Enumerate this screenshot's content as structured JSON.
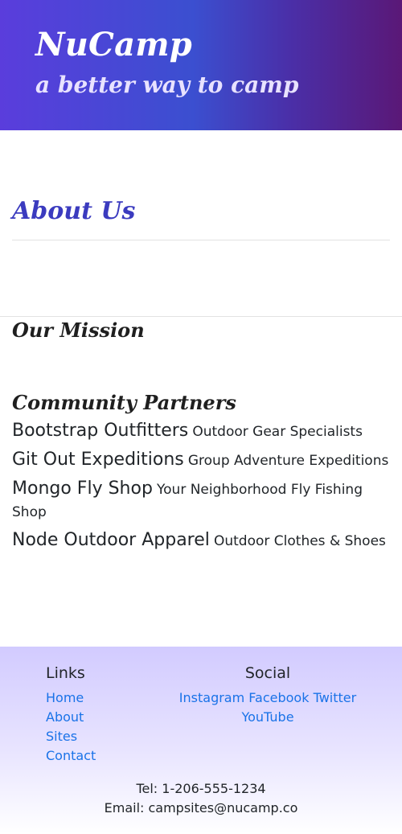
{
  "header": {
    "brand": "NuCamp",
    "tagline": "a better way to camp"
  },
  "about": {
    "title": "About Us"
  },
  "mission": {
    "heading": "Our Mission"
  },
  "partners": {
    "heading": "Community Partners",
    "items": [
      {
        "name": "Bootstrap Outfitters",
        "description": "Outdoor Gear Specialists"
      },
      {
        "name": "Git Out Expeditions",
        "description": "Group Adventure Expeditions"
      },
      {
        "name": "Mongo Fly Shop",
        "description": "Your Neighborhood Fly Fishing Shop"
      },
      {
        "name": "Node Outdoor Apparel",
        "description": "Outdoor Clothes & Shoes"
      }
    ]
  },
  "footer": {
    "links_title": "Links",
    "links": [
      "Home",
      "About",
      "Sites",
      "Contact"
    ],
    "social_title": "Social",
    "social": [
      "Instagram",
      "Facebook",
      "Twitter",
      "YouTube"
    ],
    "tel": "Tel: 1-206-555-1234",
    "email": "Email: campsites@nucamp.co"
  },
  "colors": {
    "header_gradient_start": "#5a3ddc",
    "header_gradient_end": "#5a1877",
    "about_title": "#3b3bbf",
    "link": "#1a73e8",
    "footer_gradient_top": "#d2cbff"
  }
}
